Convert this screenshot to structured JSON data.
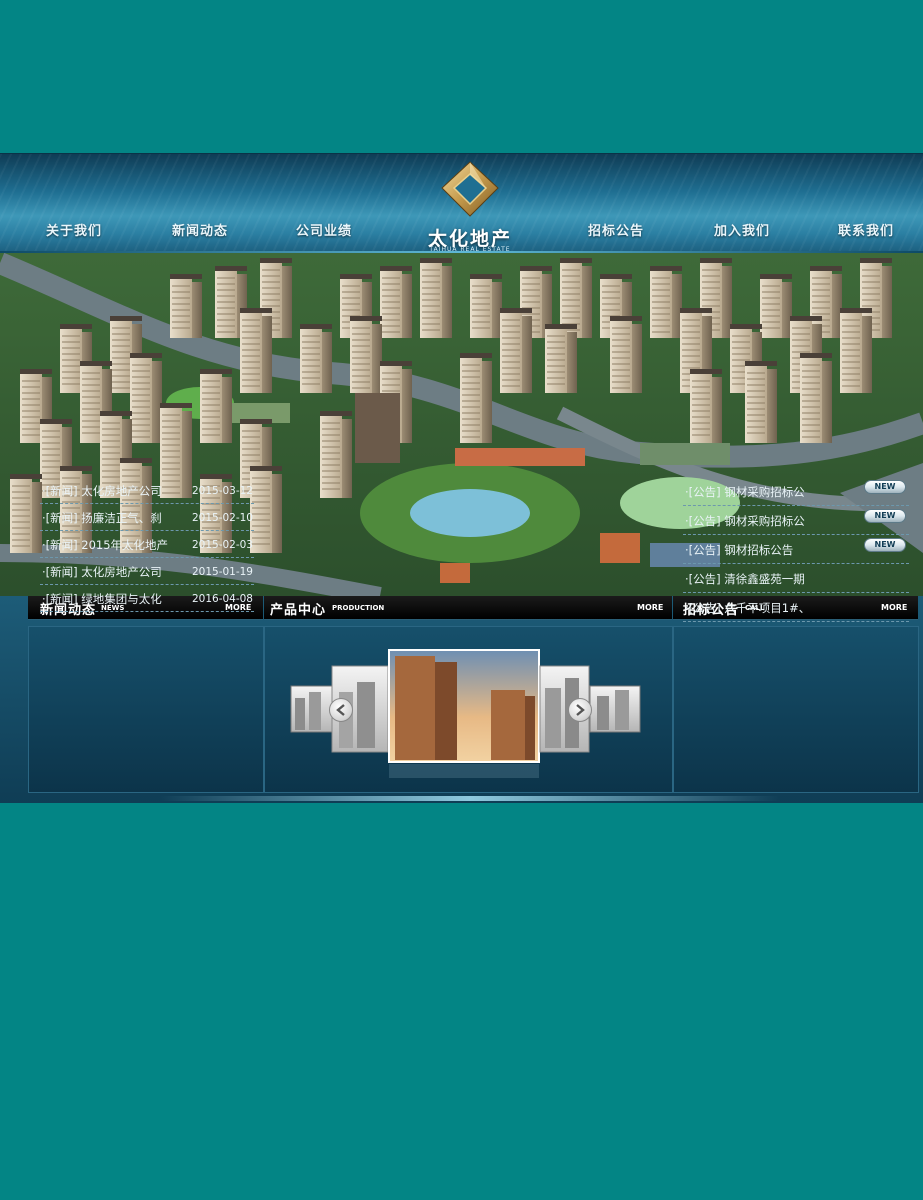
{
  "header": {
    "nav_left": [
      "关于我们",
      "新闻动态",
      "公司业绩"
    ],
    "logo_text": "太化地产",
    "logo_sub": "TAIHUA REAL ESTATE",
    "nav_right": [
      "招标公告",
      "加入我们",
      "联系我们"
    ]
  },
  "news": {
    "title": "新闻动态",
    "title_en": "NEWS",
    "more": "MORE",
    "items": [
      {
        "text": "·[新闻] 太化房地产公司",
        "date": "2015-03-12"
      },
      {
        "text": "·[新闻] 扬廉洁正气、刹",
        "date": "2015-02-10"
      },
      {
        "text": "·[新闻] 2015年太化地产",
        "date": "2015-02-03"
      },
      {
        "text": "·[新闻] 太化房地产公司",
        "date": "2015-01-19"
      },
      {
        "text": "·[新闻] 绿地集团与太化",
        "date": "2016-04-08"
      }
    ]
  },
  "production": {
    "title": "产品中心",
    "title_en": "PRODUCTION",
    "more": "MORE"
  },
  "call": {
    "title": "招标公告",
    "title_en": "CALL",
    "more": "MORE",
    "badge": "NEW",
    "items": [
      {
        "text": "·[公告] 钢材采购招标公",
        "new": true
      },
      {
        "text": "·[公告] 钢材采购招标公",
        "new": true
      },
      {
        "text": "·[公告] 钢材招标公告",
        "new": true
      },
      {
        "text": "·[公告] 清徐鑫盛苑一期",
        "new": false
      },
      {
        "text": "·[公告] 六千平项目1#、",
        "new": false
      }
    ]
  },
  "colors": {
    "page_bg": "#038585",
    "header_blue": "#2b7fa2",
    "panel_bg": "#0f3d55",
    "gold": "#c9a45b"
  }
}
